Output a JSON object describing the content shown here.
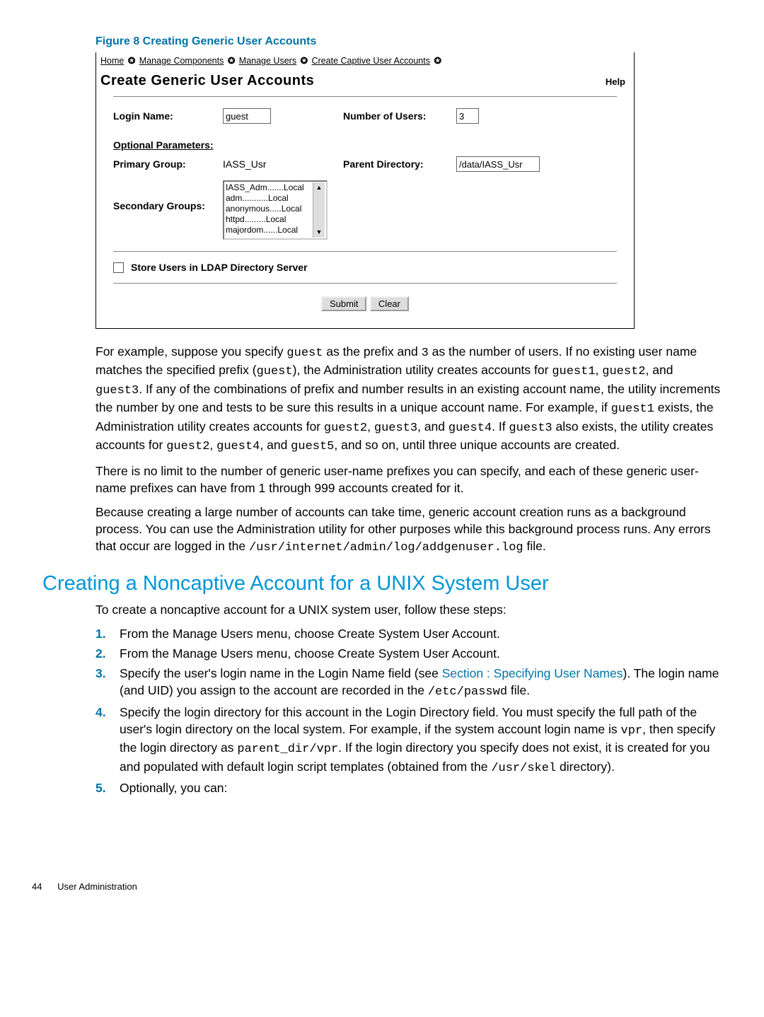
{
  "figure_caption": "Figure 8 Creating Generic User Accounts",
  "screenshot": {
    "breadcrumb": [
      "Home",
      "Manage Components",
      "Manage Users",
      "Create Captive User Accounts"
    ],
    "title": "Create Generic User Accounts",
    "help": "Help",
    "login_name_label": "Login Name:",
    "login_name_value": "guest",
    "num_users_label": "Number of Users:",
    "num_users_value": "3",
    "optional_header": "Optional Parameters:",
    "primary_group_label": "Primary Group:",
    "primary_group_value": "IASS_Usr",
    "parent_dir_label": "Parent Directory:",
    "parent_dir_value": "/data/IASS_Usr",
    "secondary_groups_label": "Secondary Groups:",
    "secondary_groups_items": "IASS_Adm.......Local\nadm...........Local\nanonymous.....Local\nhttpd.........Local\nmajordom......Local",
    "ldap_label": "Store Users in LDAP Directory Server",
    "submit": "Submit",
    "clear": "Clear"
  },
  "para1_pre": "For example, suppose you specify ",
  "para1_guest": "guest",
  "para1_mid1": " as the prefix and ",
  "para1_three": "3",
  "para1_mid2": " as the number of users. If no existing user name matches the specified prefix (",
  "para1_guestp": "guest",
  "para1_mid3": "), the Administration utility creates accounts for ",
  "para1_g1": "guest1",
  "para1_c1": ", ",
  "para1_g2": "guest2",
  "para1_c2": ", and ",
  "para1_g3": "guest3",
  "para1_mid4": ". If any of the combinations of prefix and number results in an existing account name, the utility increments the number by one and tests to be sure this results in a unique account name. For example, if ",
  "para1_g1b": "guest1",
  "para1_mid5": " exists, the Administration utility creates accounts for ",
  "para1_g2b": "guest2",
  "para1_c3": ", ",
  "para1_g3b": "guest3",
  "para1_c4": ", and ",
  "para1_g4": "guest4",
  "para1_mid6": ". If ",
  "para1_g3c": "guest3",
  "para1_mid7": " also exists, the utility creates accounts for ",
  "para1_g2c": "guest2",
  "para1_c5": ", ",
  "para1_g4b": "guest4",
  "para1_c6": ", and ",
  "para1_g5": "guest5",
  "para1_end": ", and so on, until three unique accounts are created.",
  "para2": "There is no limit to the number of generic user-name prefixes you can specify, and each of these generic user-name prefixes can have from 1 through 999 accounts created for it.",
  "para3_pre": "Because creating a large number of accounts can take time, generic account creation runs as a background process. You can use the Administration utility for other purposes while this background process runs. Any errors that occur are logged in the ",
  "para3_path": "/usr/internet/admin/log/addgenuser.log",
  "para3_end": " file.",
  "heading": "Creating a Noncaptive Account for a UNIX System User",
  "intro": "To create a noncaptive account for a UNIX system user, follow these steps:",
  "steps": {
    "s1": "From the Manage Users menu, choose Create System User Account.",
    "s2": "From the Manage Users menu, choose Create System User Account.",
    "s3_pre": "Specify the user's login name in the Login Name field (see ",
    "s3_link": "Section : Specifying User Names",
    "s3_mid": "). The login name (and UID) you assign to the account are recorded in the ",
    "s3_path": "/etc/passwd",
    "s3_end": " file.",
    "s4_pre": "Specify the login directory for this account in the Login Directory field. You must specify the full path of the user's login directory on the local system. For example, if the system account login name is ",
    "s4_vpr": "vpr",
    "s4_mid1": ", then specify the login directory as ",
    "s4_path": "parent_dir/vpr",
    "s4_mid2": ". If the login directory you specify does not exist, it is created for you and populated with default login script templates (obtained from the ",
    "s4_skel": "/usr/skel",
    "s4_end": " directory).",
    "s5": "Optionally, you can:"
  },
  "footer_page": "44",
  "footer_text": "User Administration"
}
